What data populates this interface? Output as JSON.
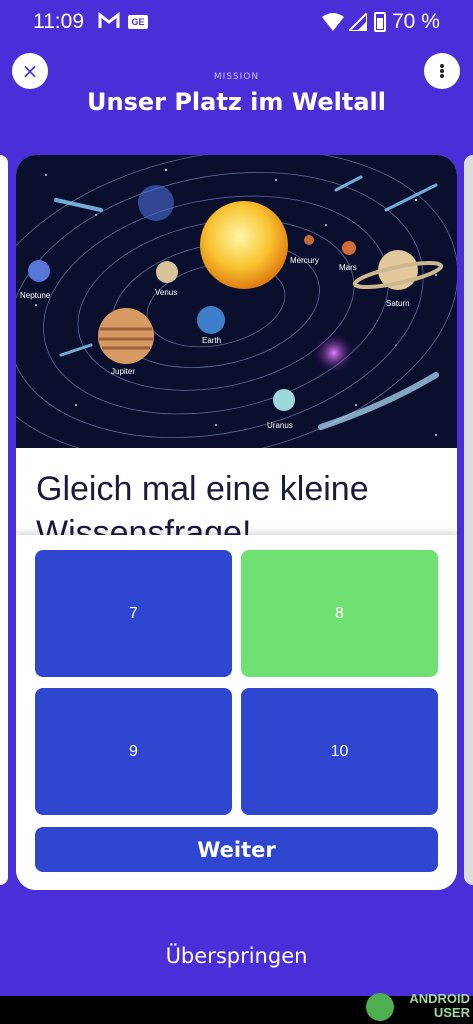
{
  "status_bar": {
    "time": "11:09",
    "battery": "70 %",
    "notif_ge": "GE"
  },
  "header": {
    "eyebrow": "MISSION",
    "title": "Unser Platz im Weltall",
    "close_symbol": "×"
  },
  "illustration": {
    "planet_labels": {
      "neptune": "Neptune",
      "venus": "Venus",
      "earth": "Earth",
      "mercury": "Mercury",
      "mars": "Mars",
      "saturn": "Saturn",
      "jupiter": "Jupiter",
      "uranus": "Uranus"
    }
  },
  "question": {
    "text": "Gleich mal eine kleine Wissensfrage!"
  },
  "answers": [
    {
      "label": "7",
      "selected": false
    },
    {
      "label": "8",
      "selected": true
    },
    {
      "label": "9",
      "selected": false
    },
    {
      "label": "10",
      "selected": false
    }
  ],
  "actions": {
    "continue_label": "Weiter",
    "skip_label": "Überspringen"
  },
  "watermark": {
    "line1": "ANDROID",
    "line2": "USER"
  },
  "colors": {
    "background": "#4a2fd8",
    "option_blue": "#2f46d1",
    "option_selected": "#6fe071"
  }
}
